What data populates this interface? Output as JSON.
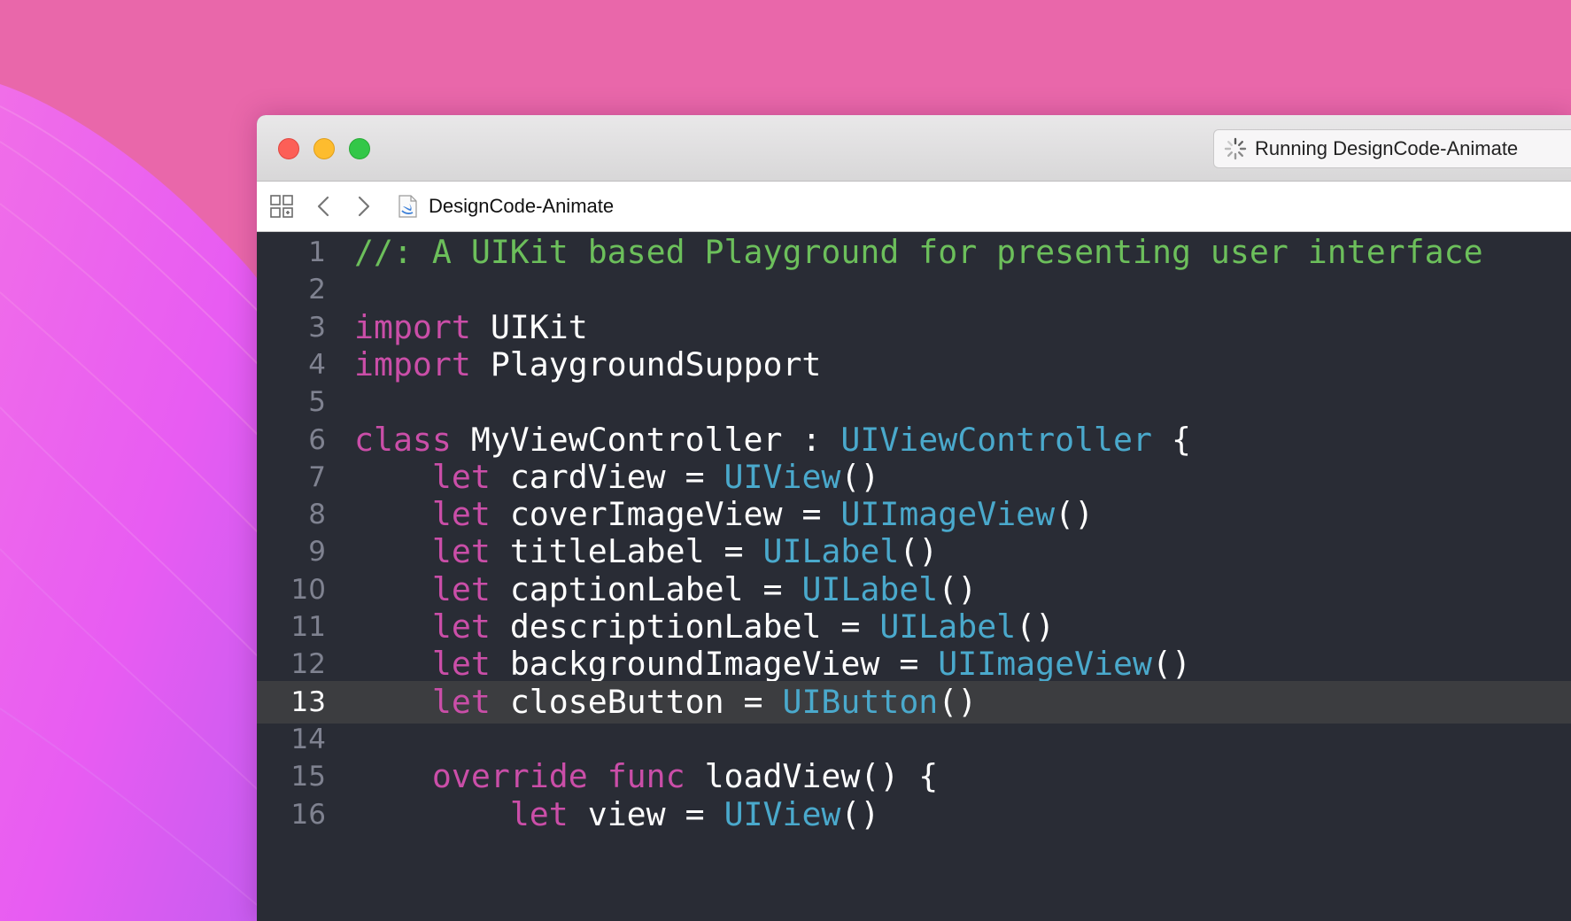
{
  "window": {
    "status_text": "Running DesignCode-Animate",
    "status_icon": "activity-spinner-icon"
  },
  "jumpbar": {
    "icons": [
      "related-items-grid-icon",
      "back-chevron-icon",
      "forward-chevron-icon",
      "swift-file-icon"
    ],
    "file_name": "DesignCode-Animate"
  },
  "editor": {
    "current_line": 13,
    "colors": {
      "background": "#292c35",
      "current_line": "#3c3d40",
      "comment": "#6cbf5b",
      "keyword": "#ca4ea8",
      "type": "#4aa9cc",
      "plain": "#ffffff",
      "line_number": "#7f8290"
    },
    "lines": [
      {
        "number": "1",
        "tokens": [
          {
            "text": "//: A UIKit based Playground for presenting user interface",
            "kind": "comment"
          }
        ]
      },
      {
        "number": "2",
        "tokens": []
      },
      {
        "number": "3",
        "tokens": [
          {
            "text": "import",
            "kind": "keyword"
          },
          {
            "text": " UIKit",
            "kind": "plain"
          }
        ]
      },
      {
        "number": "4",
        "tokens": [
          {
            "text": "import",
            "kind": "keyword"
          },
          {
            "text": " PlaygroundSupport",
            "kind": "plain"
          }
        ]
      },
      {
        "number": "5",
        "tokens": []
      },
      {
        "number": "6",
        "tokens": [
          {
            "text": "class",
            "kind": "keyword"
          },
          {
            "text": " MyViewController : ",
            "kind": "plain"
          },
          {
            "text": "UIViewController",
            "kind": "type"
          },
          {
            "text": " {",
            "kind": "plain"
          }
        ]
      },
      {
        "number": "7",
        "tokens": [
          {
            "text": "    ",
            "kind": "plain"
          },
          {
            "text": "let",
            "kind": "keyword"
          },
          {
            "text": " cardView = ",
            "kind": "plain"
          },
          {
            "text": "UIView",
            "kind": "type"
          },
          {
            "text": "()",
            "kind": "plain"
          }
        ]
      },
      {
        "number": "8",
        "tokens": [
          {
            "text": "    ",
            "kind": "plain"
          },
          {
            "text": "let",
            "kind": "keyword"
          },
          {
            "text": " coverImageView = ",
            "kind": "plain"
          },
          {
            "text": "UIImageView",
            "kind": "type"
          },
          {
            "text": "()",
            "kind": "plain"
          }
        ]
      },
      {
        "number": "9",
        "tokens": [
          {
            "text": "    ",
            "kind": "plain"
          },
          {
            "text": "let",
            "kind": "keyword"
          },
          {
            "text": " titleLabel = ",
            "kind": "plain"
          },
          {
            "text": "UILabel",
            "kind": "type"
          },
          {
            "text": "()",
            "kind": "plain"
          }
        ]
      },
      {
        "number": "10",
        "tokens": [
          {
            "text": "    ",
            "kind": "plain"
          },
          {
            "text": "let",
            "kind": "keyword"
          },
          {
            "text": " captionLabel = ",
            "kind": "plain"
          },
          {
            "text": "UILabel",
            "kind": "type"
          },
          {
            "text": "()",
            "kind": "plain"
          }
        ]
      },
      {
        "number": "11",
        "tokens": [
          {
            "text": "    ",
            "kind": "plain"
          },
          {
            "text": "let",
            "kind": "keyword"
          },
          {
            "text": " descriptionLabel = ",
            "kind": "plain"
          },
          {
            "text": "UILabel",
            "kind": "type"
          },
          {
            "text": "()",
            "kind": "plain"
          }
        ]
      },
      {
        "number": "12",
        "tokens": [
          {
            "text": "    ",
            "kind": "plain"
          },
          {
            "text": "let",
            "kind": "keyword"
          },
          {
            "text": " backgroundImageView = ",
            "kind": "plain"
          },
          {
            "text": "UIImageView",
            "kind": "type"
          },
          {
            "text": "()",
            "kind": "plain"
          }
        ]
      },
      {
        "number": "13",
        "tokens": [
          {
            "text": "    ",
            "kind": "plain"
          },
          {
            "text": "let",
            "kind": "keyword"
          },
          {
            "text": " closeButton = ",
            "kind": "plain"
          },
          {
            "text": "UIButton",
            "kind": "type"
          },
          {
            "text": "()",
            "kind": "plain"
          }
        ]
      },
      {
        "number": "14",
        "tokens": []
      },
      {
        "number": "15",
        "tokens": [
          {
            "text": "    ",
            "kind": "plain"
          },
          {
            "text": "override",
            "kind": "keyword"
          },
          {
            "text": " ",
            "kind": "plain"
          },
          {
            "text": "func",
            "kind": "keyword"
          },
          {
            "text": " loadView() {",
            "kind": "plain"
          }
        ]
      },
      {
        "number": "16",
        "tokens": [
          {
            "text": "        ",
            "kind": "plain"
          },
          {
            "text": "let",
            "kind": "keyword"
          },
          {
            "text": " view = ",
            "kind": "plain"
          },
          {
            "text": "UIView",
            "kind": "type"
          },
          {
            "text": "()",
            "kind": "plain"
          }
        ]
      }
    ]
  }
}
